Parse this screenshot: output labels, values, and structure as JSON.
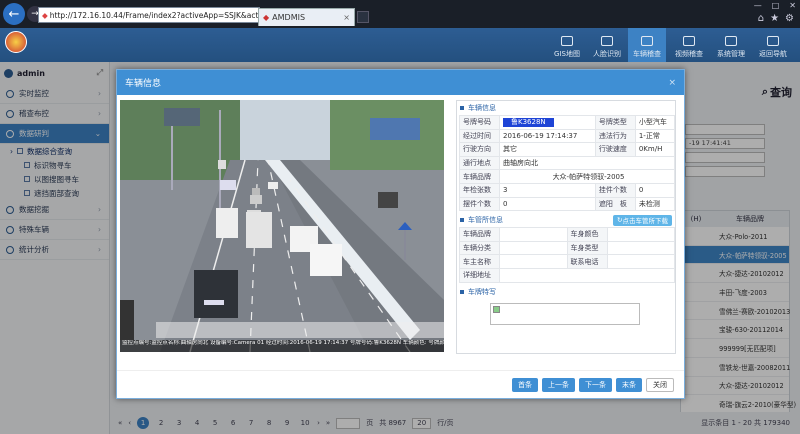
{
  "browser": {
    "url": "http://172.16.10.44/Frame/index2?activeApp=SSJK&act=...",
    "tab_title": "AMDMIS",
    "win_controls": [
      "—",
      "□",
      "✕"
    ],
    "tools": [
      "⌂",
      "★",
      "⚙"
    ]
  },
  "topnav": [
    {
      "label": "GIS地图"
    },
    {
      "label": "人脸识别"
    },
    {
      "label": "车辆稽查"
    },
    {
      "label": "视频稽查"
    },
    {
      "label": "系统管理"
    },
    {
      "label": "返回导航"
    }
  ],
  "sidebar": {
    "user": "admin",
    "items": [
      {
        "label": "实时监控"
      },
      {
        "label": "稽查布控"
      },
      {
        "label": "数据研判"
      },
      {
        "label": "数据挖掘"
      },
      {
        "label": "特殊车辆"
      },
      {
        "label": "统计分析"
      }
    ],
    "subs": [
      {
        "label": "数据综合查询"
      },
      {
        "label": "标识物寻车"
      },
      {
        "label": "以图搜图寻车"
      },
      {
        "label": "遮挡面部查询"
      }
    ]
  },
  "main": {
    "search_label": "查询",
    "date_field": "-19 17:41:41",
    "table_header": [
      "(H)",
      "车辆品牌"
    ],
    "rows": [
      "大众-Polo-2011",
      "大众-帕萨特领驭-2005",
      "大众-捷达-20102012",
      "丰田-飞度-2003",
      "雪佛兰-赛欧-20102013",
      "宝骏-630-20112014",
      "999999[无匹配项]",
      "雪铁龙-世嘉-20082011",
      "大众-捷达-20102012",
      "奇瑞-旗云2-2010(豪华型)"
    ]
  },
  "pager": {
    "pages": [
      "1",
      "2",
      "3",
      "4",
      "5",
      "6",
      "7",
      "8",
      "9",
      "10"
    ],
    "page_label": "页",
    "total": "共 8967",
    "page_size": "20",
    "per_page": "行/页",
    "display": "显示条目 1 - 20 共 179340"
  },
  "modal": {
    "title": "车辆信息",
    "close": "×",
    "vehicle_section": "车辆信息",
    "fields": {
      "plate_label": "号牌号码",
      "plate_value": "鲁K3628N",
      "plate_type_label": "号牌类型",
      "plate_type_value": "小型汽车",
      "time_label": "经过时间",
      "time_value": "2016-06-19 17:14:37",
      "violation_label": "违法行为",
      "violation_value": "1-正常",
      "direction_label": "行驶方向",
      "direction_value": "其它",
      "speed_label": "行驶速度",
      "speed_value": "0Km/H",
      "location_label": "通行地点",
      "location_value": "曲轴房向北",
      "brand_label": "车辆品牌",
      "brand_value": "大众-帕萨特领驭-2005",
      "inspect_label": "年检张数",
      "inspect_value": "3",
      "pendant_label": "挂件个数",
      "pendant_value": "0",
      "ornament_label": "摆件个数",
      "ornament_value": "0",
      "sunshade_label": "遮阳　板",
      "sunshade_value": "未检测"
    },
    "dmv_section": "车管所信息",
    "dmv_button": "点击车管所下载",
    "dmv": {
      "brand_label": "车辆品牌",
      "color_label": "车身颜色",
      "category_label": "车辆分类",
      "type_label": "车身类型",
      "owner_label": "车主名称",
      "phone_label": "联系电话",
      "address_label": "详细地址"
    },
    "feature_section": "车牌特写",
    "photo_caption": "监控点编号:监控点名称:曲轴房向北 设备编号:Camera 01 经过时间:2016-06-19 17:14:37 号牌号码:鲁K3628N 车辆颜色: 号牌颜色: 行驶方向:其它",
    "buttons": {
      "first": "首条",
      "prev": "上一条",
      "next": "下一条",
      "last": "末条",
      "close": "关闭"
    }
  }
}
